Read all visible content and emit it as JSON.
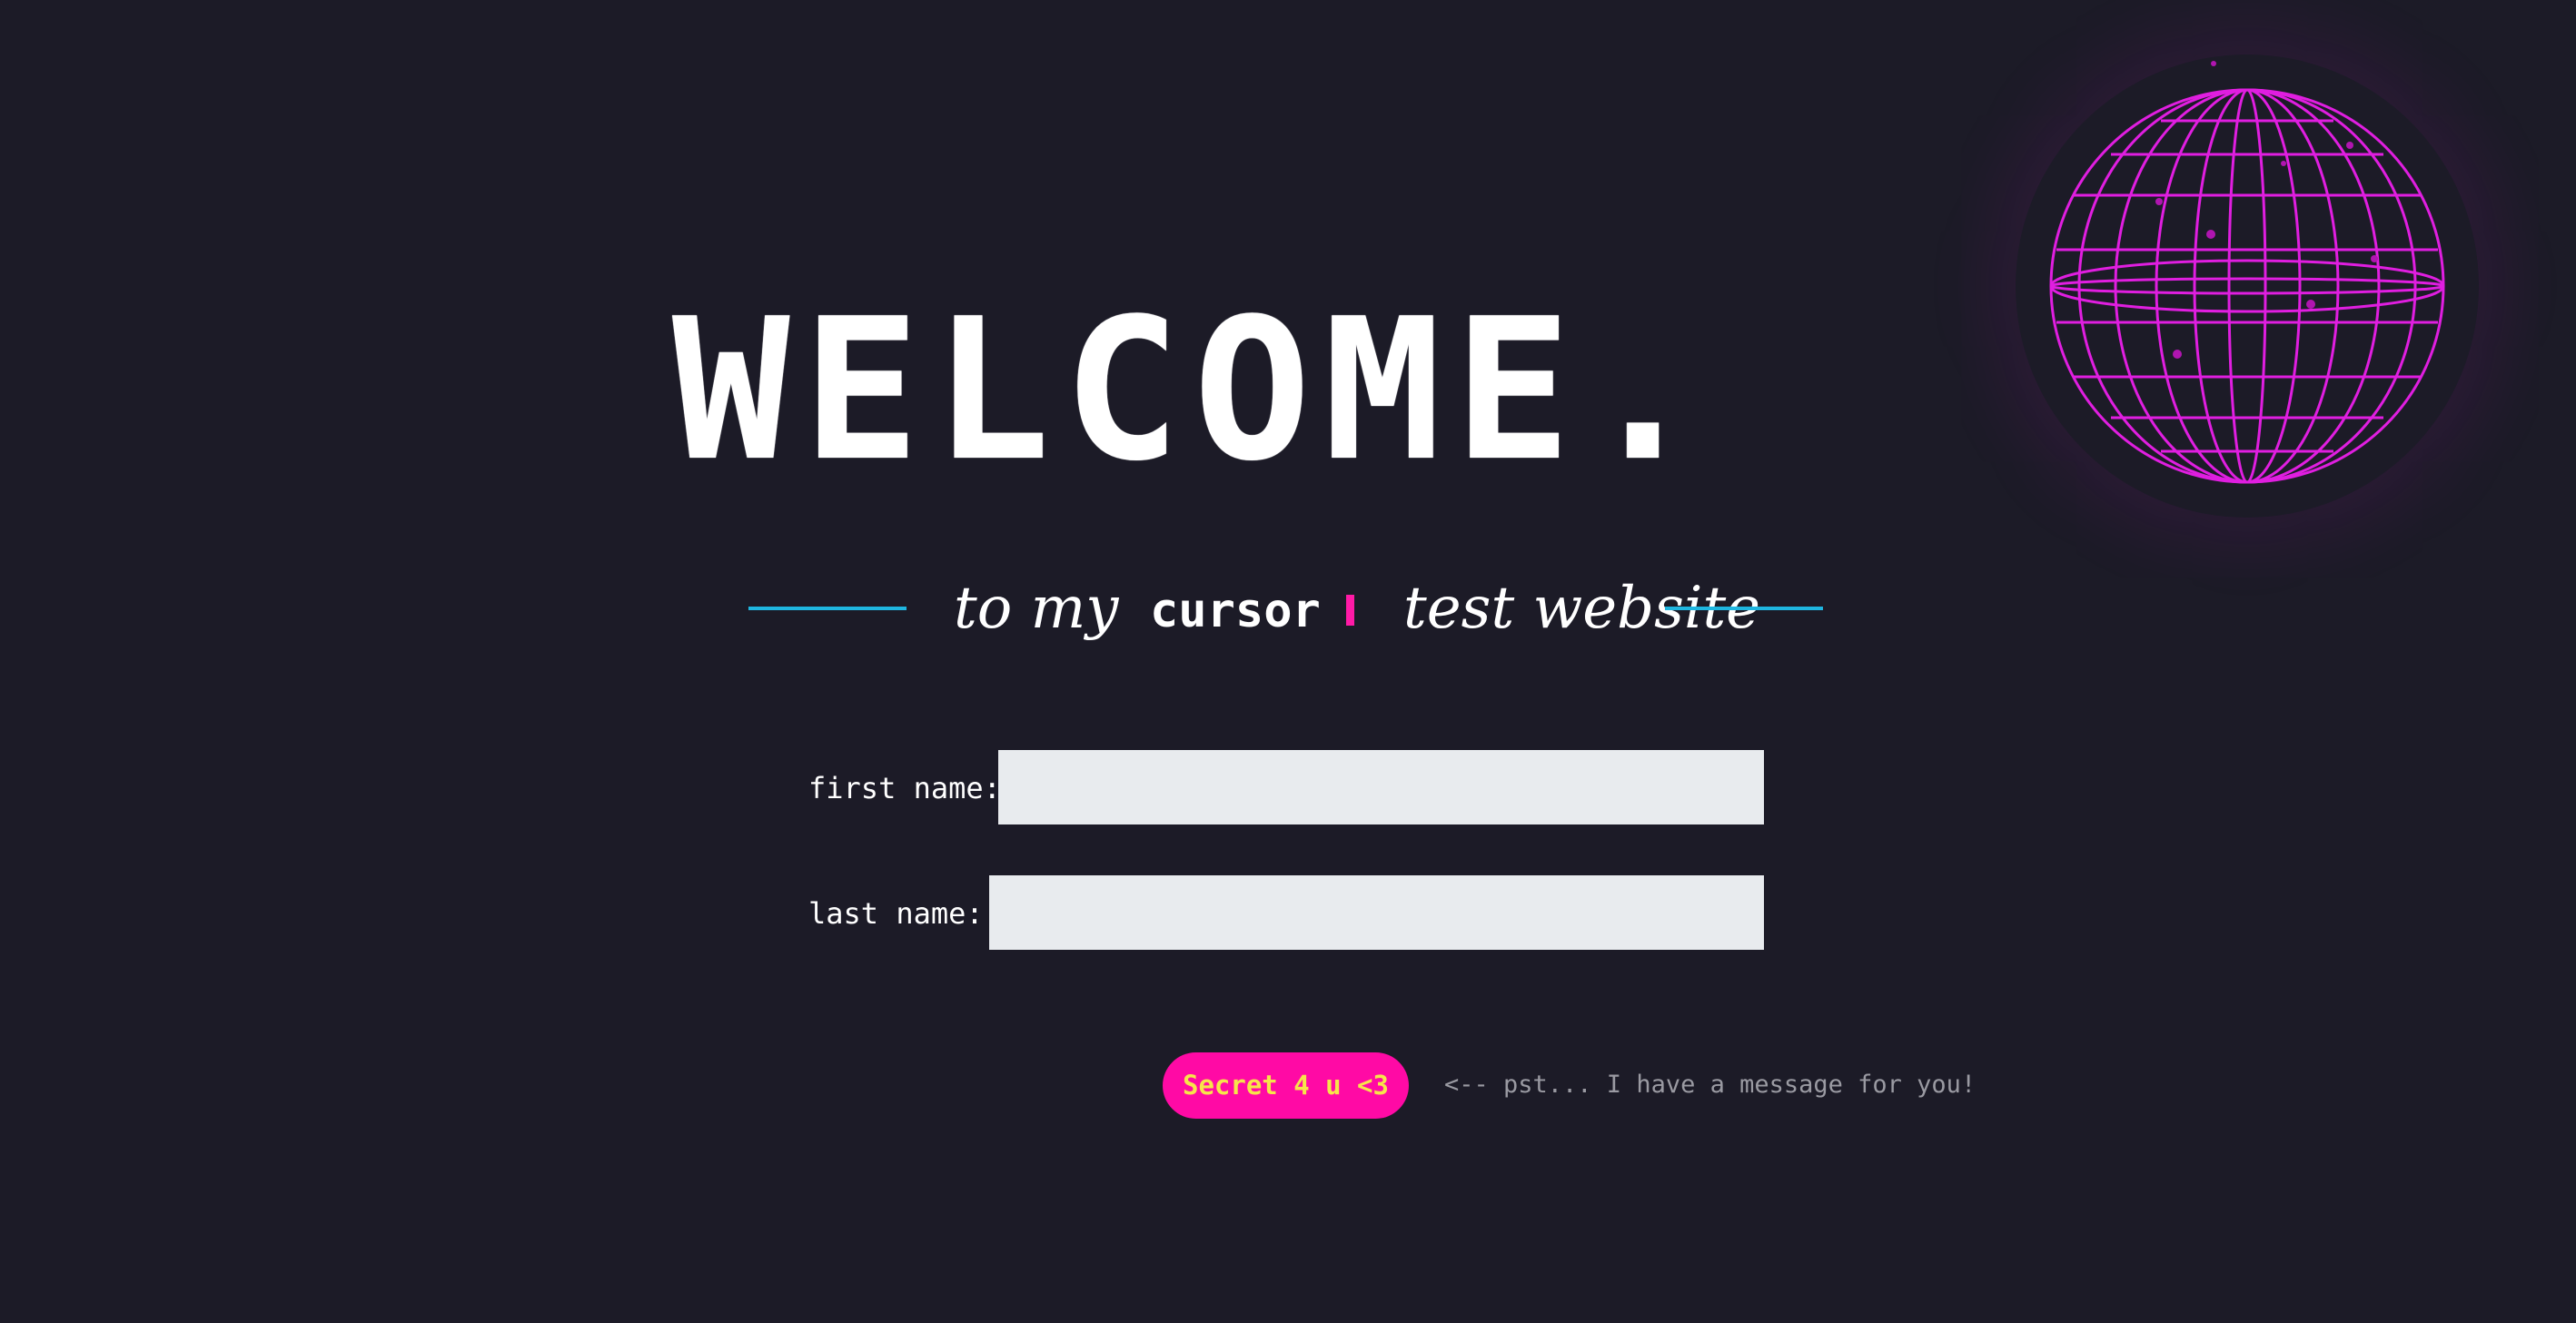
{
  "title": "WELCOME.",
  "subtitle": {
    "left": "to my",
    "highlight": "cursor",
    "right": "test website"
  },
  "form": {
    "first_name_label": "first name:",
    "first_name_value": "",
    "last_name_label": "last name:",
    "last_name_value": ""
  },
  "secret_button_label": "Secret 4 u <3",
  "hint_text": "<-- pst... I have a message for you!",
  "colors": {
    "background": "#1c1b27",
    "accent_pink": "#ff0aa5",
    "accent_cyan": "#1fb6e0",
    "button_text_yellow": "#f7e44a",
    "globe_magenta": "#e01ee0",
    "input_background": "#e8ebee"
  },
  "icons": {
    "globe": "wireframe-globe-icon"
  }
}
